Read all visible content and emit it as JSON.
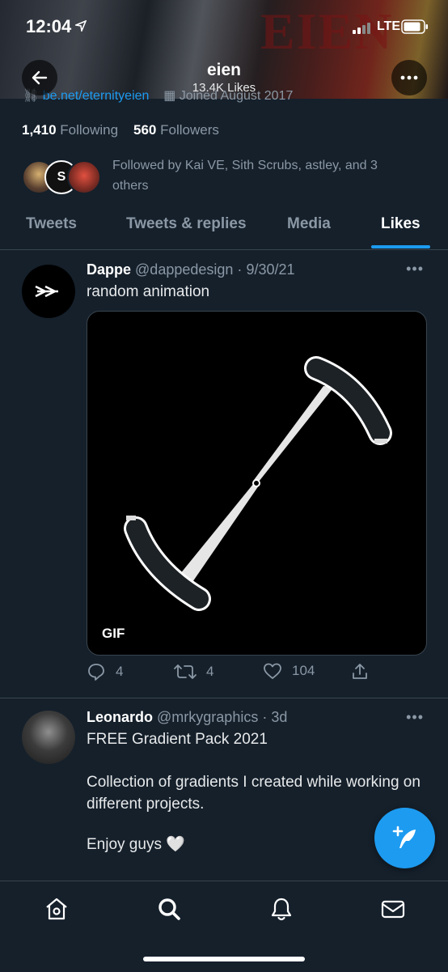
{
  "status_bar": {
    "time": "12:04",
    "network": "LTE"
  },
  "header": {
    "title": "eien",
    "subtitle": "13.4K Likes",
    "banner_text": "EIEN"
  },
  "profile": {
    "link_partial": "be.net/eternityeien",
    "joined_partial": "Joined August 2017",
    "following_count": "1,410",
    "following_label": "Following",
    "followers_count": "560",
    "followers_label": "Followers",
    "followed_by": "Followed by Kai VE, Sith Scrubs, astley, and 3 others"
  },
  "tabs": [
    {
      "label": "Tweets",
      "active": false
    },
    {
      "label": "Tweets & replies",
      "active": false
    },
    {
      "label": "Media",
      "active": false
    },
    {
      "label": "Likes",
      "active": true
    }
  ],
  "tweets": [
    {
      "name": "Dappe",
      "handle": "@dappedesign",
      "date": "9/30/21",
      "text": "random animation",
      "media_badge": "GIF",
      "replies": "4",
      "retweets": "4",
      "likes": "104"
    },
    {
      "name": "Leonardo",
      "handle": "@mrkygraphics",
      "date": "3d",
      "line1": "FREE Gradient Pack 2021",
      "line2": "Collection of gradients I created while working on different projects.",
      "line3": "Enjoy guys 🤍"
    }
  ],
  "colors": {
    "accent": "#1d9bf0",
    "background": "#15202b",
    "muted": "#8b98a5",
    "border": "#38444d"
  }
}
